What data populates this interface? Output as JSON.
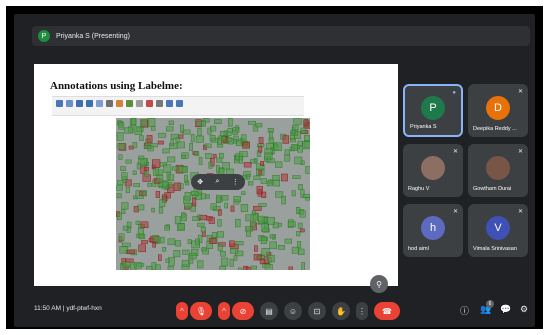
{
  "presenting": {
    "avatar_letter": "P",
    "title": "Priyanka S (Presenting)"
  },
  "slide": {
    "title": "Annotations using Labelme:",
    "canvas_controls": [
      "✥",
      "⌕",
      "⋮"
    ],
    "zoom_icon": "⚲"
  },
  "participants": [
    {
      "name": "Priyanka S",
      "letter": "P",
      "color": "#1e7a4a",
      "active": true
    },
    {
      "name": "Deepika Reddy ...",
      "letter": "D",
      "color": "#e8710a",
      "active": false
    },
    {
      "name": "Raghu V",
      "letter": "",
      "color": "#8d6e63",
      "active": false
    },
    {
      "name": "Gowtham Durai",
      "letter": "",
      "color": "#795548",
      "active": false
    },
    {
      "name": "hod aiml",
      "letter": "h",
      "color": "#5c6bc0",
      "active": false
    },
    {
      "name": "Vimala Srinivasan",
      "letter": "V",
      "color": "#3f51b5",
      "active": false
    }
  ],
  "meeting": {
    "time": "11:50 AM",
    "separator": "|",
    "code": "ydf-ptwf-hxn"
  },
  "controls": {
    "chevron": "^",
    "mic_icon": "🎙",
    "cam_icon": "⊘",
    "captions_icon": "▤",
    "emoji_icon": "☺",
    "present_icon": "⊡",
    "hand_icon": "✋",
    "more_icon": "⋮",
    "end_icon": "☎"
  },
  "right_controls": {
    "info_icon": "ⓘ",
    "people_icon": "👥",
    "people_count": "6",
    "chat_icon": "💬",
    "activities_icon": "⚙"
  }
}
